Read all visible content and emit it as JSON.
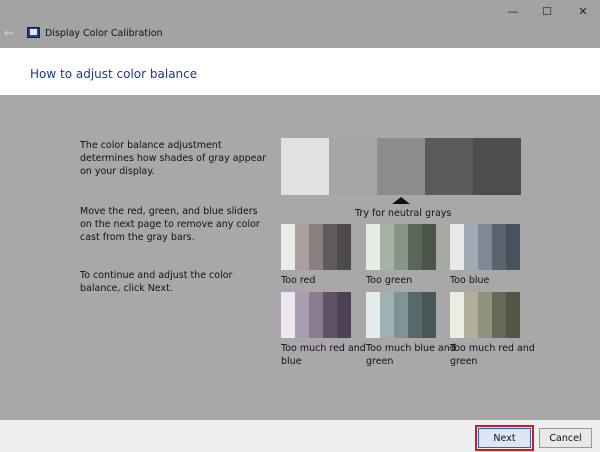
{
  "window": {
    "title": "Display Color Calibration",
    "back_icon": "back-arrow-icon",
    "controls": {
      "minimize": "—",
      "maximize": "☐",
      "close": "✕"
    }
  },
  "heading": "How to adjust color balance",
  "instructions": [
    "The color balance adjustment determines how shades of gray appear on your display.",
    "Move the red, green, and blue sliders on the next page to remove any color cast from the gray bars.",
    "To continue and adjust the color balance, click Next."
  ],
  "neutral_bars": {
    "colors": [
      "#e1e1e1",
      "#a6a6a6",
      "#8c8c8c",
      "#5a5a5a",
      "#4d4d4d"
    ],
    "label": "Try for neutral grays"
  },
  "examples": [
    {
      "label": "Too red",
      "colors": [
        "#ebebeb",
        "#ab9fa0",
        "#8b8080",
        "#615a5a",
        "#4f4a4a"
      ]
    },
    {
      "label": "Too green",
      "colors": [
        "#e6ebe6",
        "#a6b2a4",
        "#889488",
        "#5b665b",
        "#4b544b"
      ]
    },
    {
      "label": "Too blue",
      "colors": [
        "#e6e8ec",
        "#a0a9b3",
        "#7f8a96",
        "#596470",
        "#49525c"
      ]
    },
    {
      "label": "Too much red and blue",
      "colors": [
        "#ece6ee",
        "#aa9cb1",
        "#8a7b93",
        "#5e5168",
        "#4b4256"
      ]
    },
    {
      "label": "Too much blue and green",
      "colors": [
        "#e5ecec",
        "#9fb2b2",
        "#7e9494",
        "#576969",
        "#475757"
      ]
    },
    {
      "label": "Too much red and green",
      "colors": [
        "#ecece2",
        "#b0b09a",
        "#92927c",
        "#686856",
        "#555544"
      ]
    }
  ],
  "footer": {
    "next": "Next",
    "cancel": "Cancel"
  }
}
